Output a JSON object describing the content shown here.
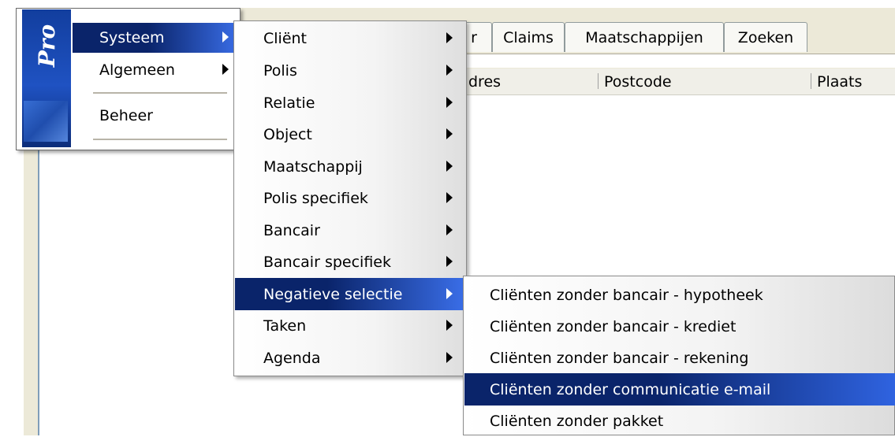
{
  "tabs": [
    {
      "label": "r"
    },
    {
      "label": "Claims"
    },
    {
      "label": "Maatschappijen"
    },
    {
      "label": "Zoeken"
    }
  ],
  "table": {
    "columns": [
      "dres",
      "Postcode",
      "Plaats"
    ]
  },
  "brand": {
    "logo_text": "Pro"
  },
  "start_menu": {
    "items": [
      {
        "label": "Systeem",
        "has_submenu": true,
        "selected": true
      },
      {
        "label": "Algemeen",
        "has_submenu": true,
        "selected": false
      },
      {
        "label": "Beheer",
        "has_submenu": false,
        "selected": false
      }
    ]
  },
  "submenu_systeem": {
    "items": [
      {
        "label": "Cliënt"
      },
      {
        "label": "Polis"
      },
      {
        "label": "Relatie"
      },
      {
        "label": "Object"
      },
      {
        "label": "Maatschappij"
      },
      {
        "label": "Polis specifiek"
      },
      {
        "label": "Bancair"
      },
      {
        "label": "Bancair specifiek"
      },
      {
        "label": "Negatieve selectie",
        "selected": true
      },
      {
        "label": "Taken"
      },
      {
        "label": "Agenda"
      }
    ]
  },
  "submenu_negatieve_selectie": {
    "items": [
      {
        "label": "Cliënten zonder bancair - hypotheek"
      },
      {
        "label": "Cliënten zonder bancair - krediet"
      },
      {
        "label": "Cliënten zonder bancair - rekening"
      },
      {
        "label": "Cliënten zonder communicatie e-mail",
        "selected": true
      },
      {
        "label": "Cliënten zonder pakket"
      }
    ]
  },
  "colors": {
    "selection": "#0a246a",
    "selection_gradient_end": "#3a6ee8",
    "brand_strip": "#1f52c2"
  }
}
